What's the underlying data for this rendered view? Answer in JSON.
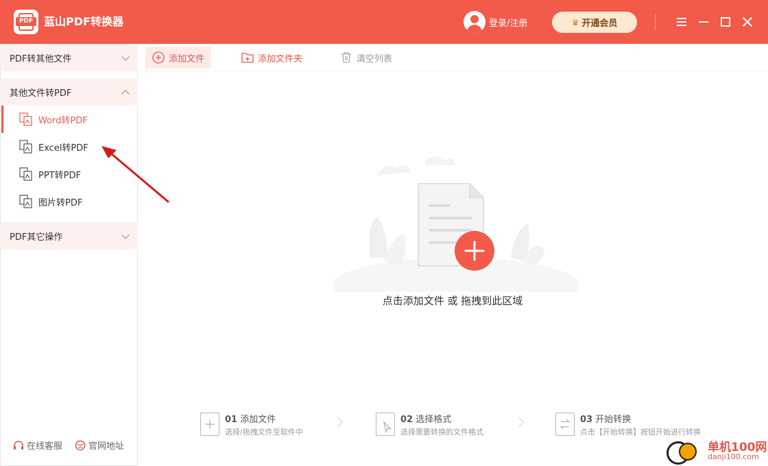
{
  "app": {
    "title": "蓝山PDF转换器",
    "logo_text": "PDF"
  },
  "header": {
    "login_label": "登录/注册",
    "vip_label": "开通会员"
  },
  "sidebar": {
    "sections": [
      {
        "label": "PDF转其他文件",
        "expanded": false
      },
      {
        "label": "其他文件转PDF",
        "expanded": true
      },
      {
        "label": "PDF其它操作",
        "expanded": false
      }
    ],
    "items": [
      {
        "label": "Word转PDF",
        "active": true
      },
      {
        "label": "Excel转PDF",
        "active": false
      },
      {
        "label": "PPT转PDF",
        "active": false
      },
      {
        "label": "图片转PDF",
        "active": false
      }
    ],
    "footer": {
      "support_label": "在线客服",
      "website_label": "官网地址"
    }
  },
  "toolbar": {
    "add_file_label": "添加文件",
    "add_folder_label": "添加文件夹",
    "clear_list_label": "清空列表"
  },
  "main": {
    "drop_hint": "点击添加文件 或 拖拽到此区域"
  },
  "steps": [
    {
      "num": "01",
      "title": "添加文件",
      "desc": "选择/拖拽文件至软件中"
    },
    {
      "num": "02",
      "title": "选择格式",
      "desc": "选择需要转换的文件格式"
    },
    {
      "num": "03",
      "title": "开始转换",
      "desc": "点击【开始转换】按钮开始进行转换"
    }
  ],
  "watermark": {
    "line1": "单机100网",
    "line2": "danji100.com"
  },
  "colors": {
    "accent": "#f25a4a",
    "sidebar_header_bg": "#fdf1ef",
    "vip_bg": "#fde9d0"
  }
}
